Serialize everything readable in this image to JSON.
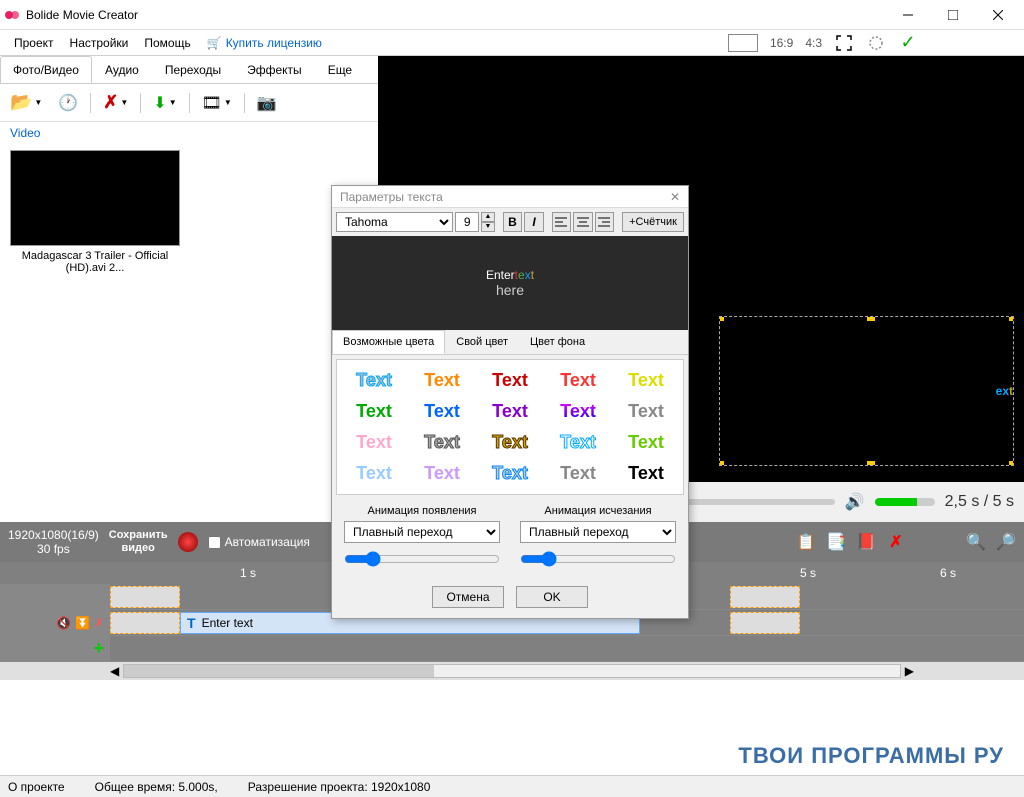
{
  "window": {
    "title": "Bolide Movie Creator"
  },
  "menubar": {
    "items": [
      "Проект",
      "Настройки",
      "Помощь"
    ],
    "buy": "Купить лицензию",
    "aspect169": "16:9",
    "aspect43": "4:3"
  },
  "tabs": {
    "items": [
      "Фото/Видео",
      "Аудио",
      "Переходы",
      "Эффекты",
      "Еще"
    ],
    "active": 0
  },
  "media": {
    "section": "Video",
    "item_caption": "Madagascar 3 Trailer - Official (HD).avi 2..."
  },
  "playback": {
    "time": "2,5 s  /  5 s"
  },
  "timeline_header": {
    "resolution": "1920x1080(16/9)",
    "fps": "30 fps",
    "save": "Сохранить\nвидео",
    "automation": "Автоматизация"
  },
  "ruler": {
    "marks": [
      "1 s",
      "5 s",
      "6 s"
    ]
  },
  "text_clip": {
    "label": "Enter text"
  },
  "statusbar": {
    "about": "О проекте",
    "duration": "Общее время:  5.000s,",
    "resolution": "Разрешение проекта:    1920x1080"
  },
  "watermark": "ТВОИ ПРОГРАММЫ РУ",
  "dialog": {
    "title": "Параметры текста",
    "font": "Tahoma",
    "size": "9",
    "counter": "+Счётчик",
    "preview_enter": "Enter ",
    "preview_text": "text",
    "preview_here": "here",
    "ctabs": [
      "Возможные цвета",
      "Свой цвет",
      "Цвет фона"
    ],
    "swatches": [
      {
        "text": "Text",
        "style": "color:#bbb; -webkit-text-stroke:1px #00aaff;"
      },
      {
        "text": "Text",
        "style": "color:#ff8800;"
      },
      {
        "text": "Text",
        "style": "color:#cc0000;"
      },
      {
        "text": "Text",
        "style": "color:#ff3333;"
      },
      {
        "text": "Text",
        "style": "color:#dddd00;"
      },
      {
        "text": "Text",
        "style": "color:#00aa00;"
      },
      {
        "text": "Text",
        "style": "color:#0066ff;"
      },
      {
        "text": "Text",
        "style": "color:#8800cc;"
      },
      {
        "text": "Text",
        "style": "background:linear-gradient(#f0f,#00f);-webkit-background-clip:text;-webkit-text-fill-color:transparent;"
      },
      {
        "text": "Text",
        "style": "color:#888;"
      },
      {
        "text": "Text",
        "style": "color:#ffaacc;"
      },
      {
        "text": "Text",
        "style": "color:#aaa;-webkit-text-stroke:1px #555;"
      },
      {
        "text": "Text",
        "style": "color:#ccaa00;-webkit-text-stroke:1px #553300;"
      },
      {
        "text": "Text",
        "style": "color:#fff;-webkit-text-stroke:1px #00aaff;"
      },
      {
        "text": "Text",
        "style": "color:#66cc00;"
      },
      {
        "text": "Text",
        "style": "color:#99ccff;"
      },
      {
        "text": "Text",
        "style": "color:#cc99ff;"
      },
      {
        "text": "Text",
        "style": "color:#ccc;-webkit-text-stroke:1px #0088ff;"
      },
      {
        "text": "Text",
        "style": "color:#888;"
      },
      {
        "text": "Text",
        "style": "color:#000;"
      }
    ],
    "anim_in_label": "Анимация появления",
    "anim_out_label": "Анимация исчезания",
    "anim_value": "Плавный переход",
    "cancel": "Отмена",
    "ok": "OK"
  }
}
